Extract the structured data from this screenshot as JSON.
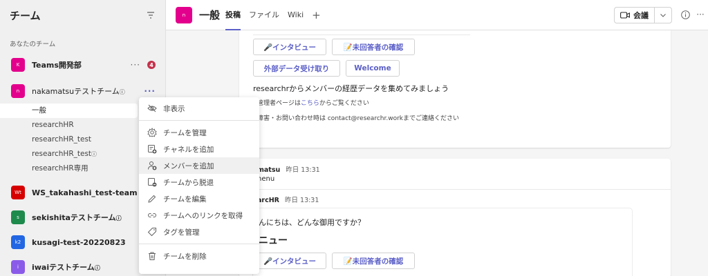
{
  "sidebar": {
    "title": "チーム",
    "section_label": "あなたのチーム",
    "teams": [
      {
        "name": "Teams開発部",
        "initial": "K",
        "color": "#e3008c",
        "badge": "4"
      },
      {
        "name": "nakamatsuテストチーム",
        "initial": "n",
        "color": "#e3008c",
        "info": "ⓘ"
      },
      {
        "name": "WS_takahashi_test-team",
        "initial": "Wt",
        "color": "#d70000"
      },
      {
        "name": "sekishitaテストチーム",
        "initial": "s",
        "color": "#1e8a4c",
        "info": "ⓘ"
      },
      {
        "name": "kusagi-test-20220823",
        "initial": "k2",
        "color": "#2266e3"
      },
      {
        "name": "iwaiテストチーム",
        "initial": "i",
        "color": "#8a5be8",
        "info": "ⓘ"
      }
    ],
    "channels": [
      {
        "name": "一般"
      },
      {
        "name": "researchHR"
      },
      {
        "name": "researchHR_test"
      },
      {
        "name": "researchHR_test",
        "info": "ⓘ"
      },
      {
        "name": "researchHR専用"
      }
    ],
    "more_glyph": "···"
  },
  "header": {
    "avatar_initial": "n",
    "channel_title": "一般",
    "tabs": [
      "投稿",
      "ファイル",
      "Wiki"
    ],
    "add_tab": "+",
    "meet_label": "会議"
  },
  "main": {
    "card1": {
      "btn_interview": "🎤インタビュー",
      "btn_unanswered": "📝未回答者の確認",
      "btn_external": "外部データ受け取り",
      "btn_welcome": "Welcome",
      "intro": "researchrからメンバーの経歴データを集めてみましょう",
      "admin_prefix": "管理者ページは",
      "admin_link": "こちら",
      "admin_suffix": "からご覧ください",
      "contact": "障害・お問い合わせ時は contact@researchr.workまでご連絡ください"
    },
    "msg1": {
      "sender": "matsu",
      "time": "昨日 13:31",
      "text": "nenu"
    },
    "msg2": {
      "sender": "arcHR",
      "time": "昨日 13:31"
    },
    "card2": {
      "greeting": "んにちは、どんな御用ですか？",
      "menu_title": "ニュー",
      "btn_interview": "🎤インタビュー",
      "btn_unanswered": "📝未回答者の確認"
    }
  },
  "context_menu": {
    "items": [
      {
        "label": "非表示"
      },
      {
        "label": "チームを管理"
      },
      {
        "label": "チャネルを追加"
      },
      {
        "label": "メンバーを追加"
      },
      {
        "label": "チームから脱退"
      },
      {
        "label": "チームを編集"
      },
      {
        "label": "チームへのリンクを取得"
      },
      {
        "label": "タグを管理"
      },
      {
        "label": "チームを削除"
      }
    ]
  }
}
